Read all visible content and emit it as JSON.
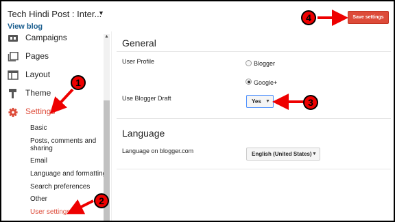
{
  "header": {
    "blog_title": "Tech Hindi Post : Inter...",
    "view_blog": "View blog",
    "save_label": "Save settings"
  },
  "sidebar": {
    "items": [
      {
        "label": "Campaigns",
        "icon": "campaigns-icon"
      },
      {
        "label": "Pages",
        "icon": "pages-icon"
      },
      {
        "label": "Layout",
        "icon": "layout-icon"
      },
      {
        "label": "Theme",
        "icon": "theme-icon"
      },
      {
        "label": "Settings",
        "icon": "gear-icon",
        "active": true
      }
    ],
    "sub_items": [
      {
        "label": "Basic"
      },
      {
        "label": "Posts, comments and"
      },
      {
        "label": "sharing"
      },
      {
        "label": "Email"
      },
      {
        "label": "Language and formatting"
      },
      {
        "label": "Search preferences"
      },
      {
        "label": "Other"
      },
      {
        "label": "User settings",
        "active": true
      }
    ]
  },
  "general": {
    "title": "General",
    "user_profile_label": "User Profile",
    "option_blogger": "Blogger",
    "option_google": "Google+",
    "selected": "Google+",
    "draft_label": "Use Blogger Draft",
    "draft_value": "Yes"
  },
  "language": {
    "title": "Language",
    "label": "Language on blogger.com",
    "value": "English (United States)"
  },
  "annotations": [
    "1",
    "2",
    "3",
    "4"
  ],
  "colors": {
    "accent": "#dd4b39",
    "link": "#1a5e8f",
    "annotation": "#e00000"
  }
}
